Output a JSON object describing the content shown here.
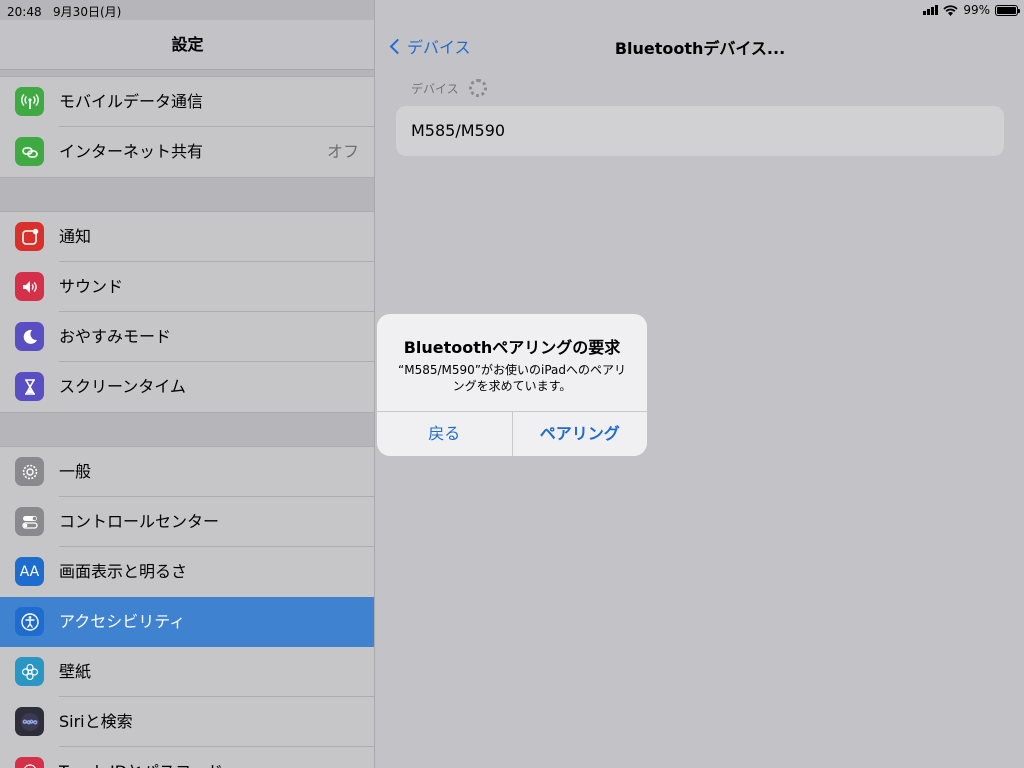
{
  "status_bar": {
    "time": "20:48",
    "date": "9月30日(月)",
    "battery": "99%",
    "battery_level": 0.99
  },
  "sidebar": {
    "title": "設定",
    "groups": [
      {
        "items": [
          {
            "label": "モバイルデータ通信",
            "icon": "antenna-icon",
            "color": "#3fa942"
          },
          {
            "label": "インターネット共有",
            "value": "オフ",
            "icon": "chain-link-icon",
            "color": "#3fa942"
          }
        ]
      },
      {
        "items": [
          {
            "label": "通知",
            "icon": "notifications-icon",
            "color": "#d8302b"
          },
          {
            "label": "サウンド",
            "icon": "speaker-icon",
            "color": "#d4304a"
          },
          {
            "label": "おやすみモード",
            "icon": "moon-icon",
            "color": "#5a4fc2"
          },
          {
            "label": "スクリーンタイム",
            "icon": "hourglass-icon",
            "color": "#5a4fc2"
          }
        ]
      },
      {
        "items": [
          {
            "label": "一般",
            "icon": "gear-icon",
            "color": "#8a8a8e"
          },
          {
            "label": "コントロールセンター",
            "icon": "toggles-icon",
            "color": "#8a8a8e"
          },
          {
            "label": "画面表示と明るさ",
            "icon": "text-size-icon",
            "color": "#1e6ccd"
          },
          {
            "label": "アクセシビリティ",
            "icon": "accessibility-icon",
            "color": "#1e6ccd",
            "selected": true
          },
          {
            "label": "壁紙",
            "icon": "flower-icon",
            "color": "#2a96c4"
          },
          {
            "label": "Siriと検索",
            "icon": "siri-icon",
            "color": "#2e2e3a"
          },
          {
            "label": "Touch IDとパスコード",
            "icon": "fingerprint-icon",
            "color": "#d4304a"
          }
        ]
      }
    ]
  },
  "detail": {
    "back_label": "デバイス",
    "title": "Bluetoothデバイス...",
    "section_header": "デバイス",
    "device_name": "M585/M590"
  },
  "alert": {
    "title": "Bluetoothペアリングの要求",
    "message": "“M585/M590”がお使いのiPadへのペアリングを求めています。",
    "cancel_label": "戻る",
    "confirm_label": "ペアリング"
  }
}
